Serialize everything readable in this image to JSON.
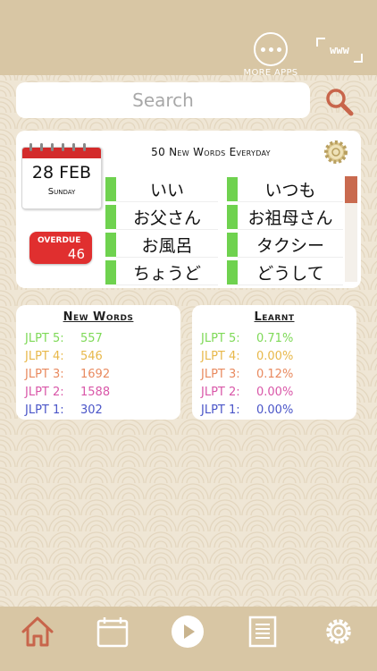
{
  "header": {
    "more_apps_label": "MORE APPS",
    "web_label": "www"
  },
  "search": {
    "placeholder": "Search"
  },
  "daily": {
    "title": "50 New Words Everyday",
    "calendar": {
      "date": "28 FEB",
      "weekday": "Sunday"
    },
    "overdue": {
      "label": "OVERDUE",
      "count": "46"
    },
    "words_left": [
      "いい",
      "お父さん",
      "お風呂",
      "ちょうど"
    ],
    "words_right": [
      "いつも",
      "お祖母さん",
      "タクシー",
      "どうして"
    ]
  },
  "new_words": {
    "title": "New Words",
    "rows": [
      {
        "label": "JLPT 5:",
        "value": "557",
        "color": "#7ed957"
      },
      {
        "label": "JLPT 4:",
        "value": "546",
        "color": "#e8b84a"
      },
      {
        "label": "JLPT 3:",
        "value": "1692",
        "color": "#e98a5f"
      },
      {
        "label": "JLPT 2:",
        "value": "1588",
        "color": "#d957a8"
      },
      {
        "label": "JLPT 1:",
        "value": "302",
        "color": "#4a55c8"
      }
    ]
  },
  "learnt": {
    "title": "Learnt",
    "rows": [
      {
        "label": "JLPT 5:",
        "value": "0.71%",
        "color": "#7ed957"
      },
      {
        "label": "JLPT 4:",
        "value": "0.00%",
        "color": "#e8b84a"
      },
      {
        "label": "JLPT 3:",
        "value": "0.12%",
        "color": "#e98a5f"
      },
      {
        "label": "JLPT 2:",
        "value": "0.00%",
        "color": "#d957a8"
      },
      {
        "label": "JLPT 1:",
        "value": "0.00%",
        "color": "#4a55c8"
      }
    ]
  },
  "tabs": [
    {
      "icon": "home-icon",
      "active": true
    },
    {
      "icon": "calendar-icon",
      "active": false
    },
    {
      "icon": "play-icon",
      "active": false
    },
    {
      "icon": "document-icon",
      "active": false
    },
    {
      "icon": "settings-icon",
      "active": false
    }
  ],
  "colors": {
    "accent": "#c8654b",
    "overdue": "#e02f2f",
    "word_bar": "#6fd24f",
    "tab_bar": "#d8c6a4"
  }
}
